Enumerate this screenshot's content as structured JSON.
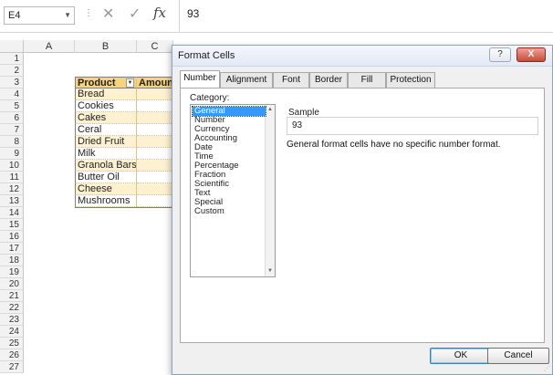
{
  "formula_bar": {
    "name_box": "E4",
    "cancel_icon": "x-icon",
    "enter_icon": "check-icon",
    "fx_label": "fx",
    "value": "93"
  },
  "sheet": {
    "columns": [
      "A",
      "B",
      "C"
    ],
    "rows": [
      "1",
      "2",
      "3",
      "4",
      "5",
      "6",
      "7",
      "8",
      "9",
      "10",
      "11",
      "12",
      "13",
      "14",
      "15",
      "16",
      "17",
      "18",
      "19",
      "20",
      "21",
      "22",
      "23",
      "24",
      "25",
      "26",
      "27"
    ],
    "table": {
      "headers": [
        "Product",
        "Amoun"
      ],
      "products": [
        "Bread",
        "Cookies",
        "Cakes",
        "Ceral",
        "Dried Fruit",
        "Milk",
        "Granola Bars",
        "Butter Oil",
        "Cheese",
        "Mushrooms"
      ]
    },
    "colors": {
      "header": "#f7d47a",
      "band": "#fdf1d2"
    }
  },
  "dialog": {
    "title": "Format Cells",
    "help_label": "?",
    "close_label": "X",
    "tabs": [
      "Number",
      "Alignment",
      "Font",
      "Border",
      "Fill",
      "Protection"
    ],
    "active_tab": "Number",
    "category_label": "Category:",
    "categories": [
      "General",
      "Number",
      "Currency",
      "Accounting",
      "Date",
      "Time",
      "Percentage",
      "Fraction",
      "Scientific",
      "Text",
      "Special",
      "Custom"
    ],
    "selected_category": "General",
    "sample_label": "Sample",
    "sample_value": "93",
    "description": "General format cells have no specific number format.",
    "ok_label": "OK",
    "cancel_label": "Cancel"
  }
}
